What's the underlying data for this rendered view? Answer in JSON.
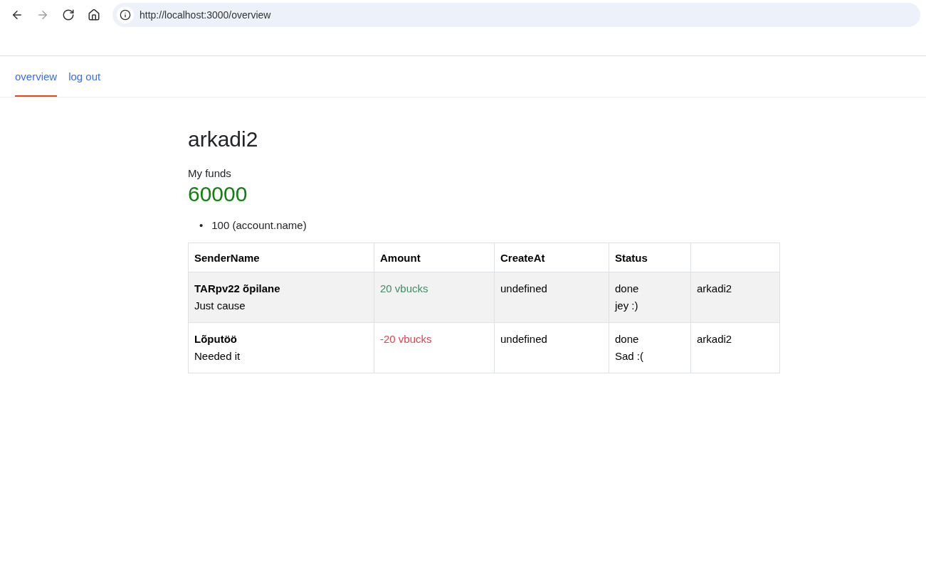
{
  "browser": {
    "buttons": [
      {
        "kind": "back",
        "disabled": false
      },
      {
        "kind": "forward",
        "disabled": true
      },
      {
        "kind": "reload",
        "disabled": false
      },
      {
        "kind": "home",
        "disabled": false
      }
    ],
    "url": "http://localhost:3000/overview"
  },
  "tabs": [
    {
      "label": "overview",
      "selected": true
    },
    {
      "label": "log out",
      "selected": false
    }
  ],
  "user": {
    "name": "arkadi2",
    "funds_label": "My funds",
    "funds": "60000"
  },
  "accounts": [
    {
      "marker": "•",
      "text": "100 (account.name)"
    }
  ],
  "table": {
    "columns": [
      "SenderName",
      "Amount",
      "CreateAt",
      "Status"
    ],
    "rows": [
      {
        "sender": "TARpv22 õpilane",
        "note": "Just cause",
        "amount": "20 vbucks",
        "kind": "incoming",
        "created": "undefined",
        "status": "done",
        "status_note": "jey :)",
        "user": "arkadi2"
      },
      {
        "sender": "Lõputöö",
        "note": "Needed it",
        "amount": "-20 vbucks",
        "kind": "outgoing",
        "created": "undefined",
        "status": "done",
        "status_note": "Sad :(",
        "user": "arkadi2"
      }
    ]
  }
}
